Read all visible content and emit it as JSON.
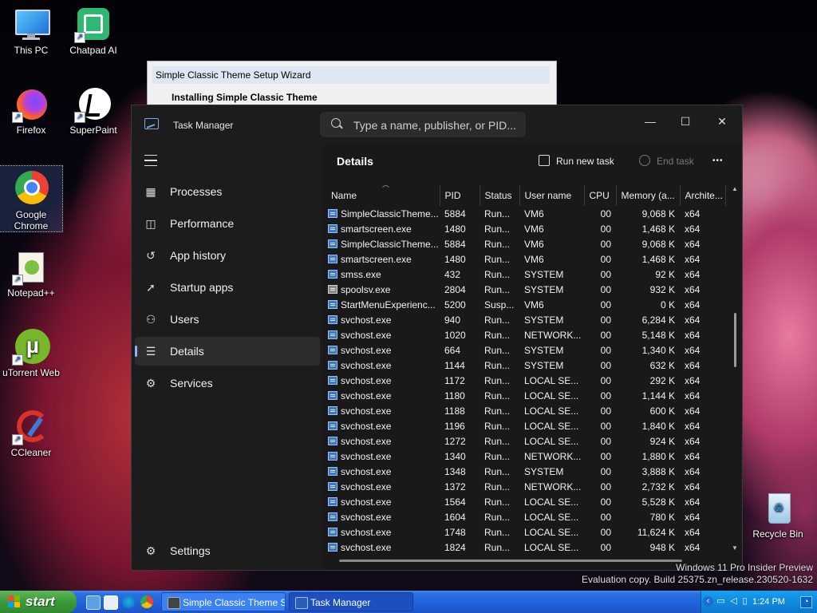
{
  "desktop": {
    "icons": [
      {
        "label": "This PC"
      },
      {
        "label": "Chatpad AI"
      },
      {
        "label": "Firefox"
      },
      {
        "label": "SuperPaint"
      },
      {
        "label": "Google Chrome"
      },
      {
        "label": "Notepad++"
      },
      {
        "label": "uTorrent Web"
      },
      {
        "label": "CCleaner"
      },
      {
        "label": "Recycle Bin"
      }
    ],
    "watermark_line1": "Windows 11 Pro Insider Preview",
    "watermark_line2": "Evaluation copy. Build 25375.zn_release.230520-1632"
  },
  "wizard": {
    "title": "Simple Classic Theme Setup Wizard",
    "subtitle": "Installing Simple Classic Theme"
  },
  "taskmanager": {
    "title": "Task Manager",
    "search_placeholder": "Type a name, publisher, or PID...",
    "window_buttons": {
      "minimize": "—",
      "maximize": "☐",
      "close": "✕"
    },
    "nav": [
      {
        "label": "Processes",
        "icon": "processes-icon",
        "glyph": "▦"
      },
      {
        "label": "Performance",
        "icon": "performance-icon",
        "glyph": "◫"
      },
      {
        "label": "App history",
        "icon": "app-history-icon",
        "glyph": "↺"
      },
      {
        "label": "Startup apps",
        "icon": "startup-apps-icon",
        "glyph": "➚"
      },
      {
        "label": "Users",
        "icon": "users-icon",
        "glyph": "⚇"
      },
      {
        "label": "Details",
        "icon": "details-icon",
        "glyph": "☰"
      },
      {
        "label": "Services",
        "icon": "services-icon",
        "glyph": "⚙"
      }
    ],
    "active_nav": "Details",
    "settings_label": "Settings",
    "page_title": "Details",
    "run_new_task": "Run new task",
    "end_task": "End task",
    "more": "•••",
    "columns": [
      "Name",
      "PID",
      "Status",
      "User name",
      "CPU",
      "Memory (a...",
      "Archite..."
    ],
    "rows": [
      {
        "name": "SimpleClassicTheme...",
        "pid": "5884",
        "status": "Run...",
        "user": "VM6",
        "cpu": "00",
        "mem": "9,068 K",
        "arch": "x64",
        "icon": "app"
      },
      {
        "name": "smartscreen.exe",
        "pid": "1480",
        "status": "Run...",
        "user": "VM6",
        "cpu": "00",
        "mem": "1,468 K",
        "arch": "x64",
        "icon": "app"
      },
      {
        "name": "SimpleClassicTheme...",
        "pid": "5884",
        "status": "Run...",
        "user": "VM6",
        "cpu": "00",
        "mem": "9,068 K",
        "arch": "x64",
        "icon": "app"
      },
      {
        "name": "smartscreen.exe",
        "pid": "1480",
        "status": "Run...",
        "user": "VM6",
        "cpu": "00",
        "mem": "1,468 K",
        "arch": "x64",
        "icon": "app"
      },
      {
        "name": "smss.exe",
        "pid": "432",
        "status": "Run...",
        "user": "SYSTEM",
        "cpu": "00",
        "mem": "92 K",
        "arch": "x64",
        "icon": "app"
      },
      {
        "name": "spoolsv.exe",
        "pid": "2804",
        "status": "Run...",
        "user": "SYSTEM",
        "cpu": "00",
        "mem": "932 K",
        "arch": "x64",
        "icon": "printer"
      },
      {
        "name": "StartMenuExperienc...",
        "pid": "5200",
        "status": "Susp...",
        "user": "VM6",
        "cpu": "00",
        "mem": "0 K",
        "arch": "x64",
        "icon": "app"
      },
      {
        "name": "svchost.exe",
        "pid": "940",
        "status": "Run...",
        "user": "SYSTEM",
        "cpu": "00",
        "mem": "6,284 K",
        "arch": "x64",
        "icon": "app"
      },
      {
        "name": "svchost.exe",
        "pid": "1020",
        "status": "Run...",
        "user": "NETWORK...",
        "cpu": "00",
        "mem": "5,148 K",
        "arch": "x64",
        "icon": "app"
      },
      {
        "name": "svchost.exe",
        "pid": "664",
        "status": "Run...",
        "user": "SYSTEM",
        "cpu": "00",
        "mem": "1,340 K",
        "arch": "x64",
        "icon": "app"
      },
      {
        "name": "svchost.exe",
        "pid": "1144",
        "status": "Run...",
        "user": "SYSTEM",
        "cpu": "00",
        "mem": "632 K",
        "arch": "x64",
        "icon": "app"
      },
      {
        "name": "svchost.exe",
        "pid": "1172",
        "status": "Run...",
        "user": "LOCAL SE...",
        "cpu": "00",
        "mem": "292 K",
        "arch": "x64",
        "icon": "app"
      },
      {
        "name": "svchost.exe",
        "pid": "1180",
        "status": "Run...",
        "user": "LOCAL SE...",
        "cpu": "00",
        "mem": "1,144 K",
        "arch": "x64",
        "icon": "app"
      },
      {
        "name": "svchost.exe",
        "pid": "1188",
        "status": "Run...",
        "user": "LOCAL SE...",
        "cpu": "00",
        "mem": "600 K",
        "arch": "x64",
        "icon": "app"
      },
      {
        "name": "svchost.exe",
        "pid": "1196",
        "status": "Run...",
        "user": "LOCAL SE...",
        "cpu": "00",
        "mem": "1,840 K",
        "arch": "x64",
        "icon": "app"
      },
      {
        "name": "svchost.exe",
        "pid": "1272",
        "status": "Run...",
        "user": "LOCAL SE...",
        "cpu": "00",
        "mem": "924 K",
        "arch": "x64",
        "icon": "app"
      },
      {
        "name": "svchost.exe",
        "pid": "1340",
        "status": "Run...",
        "user": "NETWORK...",
        "cpu": "00",
        "mem": "1,880 K",
        "arch": "x64",
        "icon": "app"
      },
      {
        "name": "svchost.exe",
        "pid": "1348",
        "status": "Run...",
        "user": "SYSTEM",
        "cpu": "00",
        "mem": "3,888 K",
        "arch": "x64",
        "icon": "app"
      },
      {
        "name": "svchost.exe",
        "pid": "1372",
        "status": "Run...",
        "user": "NETWORK...",
        "cpu": "00",
        "mem": "2,732 K",
        "arch": "x64",
        "icon": "app"
      },
      {
        "name": "svchost.exe",
        "pid": "1564",
        "status": "Run...",
        "user": "LOCAL SE...",
        "cpu": "00",
        "mem": "5,528 K",
        "arch": "x64",
        "icon": "app"
      },
      {
        "name": "svchost.exe",
        "pid": "1604",
        "status": "Run...",
        "user": "LOCAL SE...",
        "cpu": "00",
        "mem": "780 K",
        "arch": "x64",
        "icon": "app"
      },
      {
        "name": "svchost.exe",
        "pid": "1748",
        "status": "Run...",
        "user": "LOCAL SE...",
        "cpu": "00",
        "mem": "11,624 K",
        "arch": "x64",
        "icon": "app"
      },
      {
        "name": "svchost.exe",
        "pid": "1824",
        "status": "Run...",
        "user": "LOCAL SE...",
        "cpu": "00",
        "mem": "948 K",
        "arch": "x64",
        "icon": "app"
      }
    ]
  },
  "taskbar": {
    "start_label": "start",
    "buttons": [
      {
        "label": "Simple Classic Theme S...",
        "state": "inactive"
      },
      {
        "label": "Task Manager",
        "state": "active"
      }
    ],
    "clock": "1:24 PM"
  },
  "colors": {
    "accent": "#8db4ff",
    "tm_bg": "#1c1c1c",
    "taskbar_blue": "#2160d8",
    "start_green": "#3c9a3a"
  }
}
